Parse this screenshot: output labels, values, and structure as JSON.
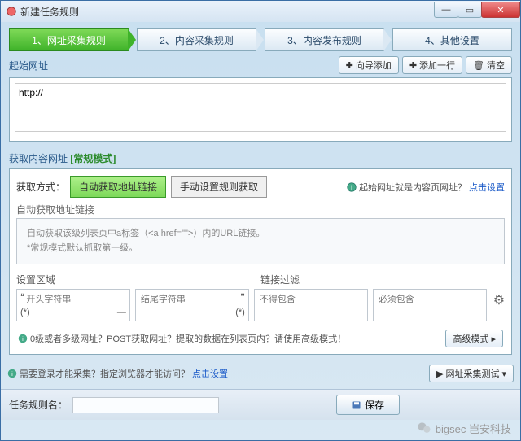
{
  "window": {
    "title": "新建任务规则"
  },
  "steps": [
    "1、网址采集规则",
    "2、内容采集规则",
    "3、内容发布规则",
    "4、其他设置"
  ],
  "start_url": {
    "label": "起始网址",
    "btn_wizard": "向导添加",
    "btn_addrow": "添加一行",
    "btn_clear": "清空",
    "value": "http://"
  },
  "content_url": {
    "label": "获取内容网址",
    "mode": "[常规模式]",
    "fetch_label": "获取方式：",
    "tab_auto": "自动获取地址链接",
    "tab_manual": "手动设置规则获取",
    "hint_q": "起始网址就是内容页网址？",
    "hint_link": "点击设置",
    "sub_label": "自动获取地址链接",
    "hint_box_l1": "自动获取该级列表页中a标签（<a href=\"\">）内的URL链接。",
    "hint_box_l2": "*常规模式默认抓取第一级。"
  },
  "area": {
    "label_area": "设置区域",
    "label_filter": "链接过滤",
    "begin_ph": "开头字符串",
    "end_ph": "结尾字符串",
    "exclude_ph": "不得包含",
    "include_ph": "必须包含"
  },
  "adv": {
    "hint": "0级或者多级网址？POST获取网址？提取的数据在列表页内？请使用高级模式！",
    "btn": "高级模式"
  },
  "footer": {
    "q": "需要登录才能采集？指定浏览器才能访问？",
    "link": "点击设置",
    "test_btn": "网址采集测试"
  },
  "save": {
    "label": "任务规则名：",
    "btn": "保存"
  },
  "watermark": "bigsec 岂安科技"
}
